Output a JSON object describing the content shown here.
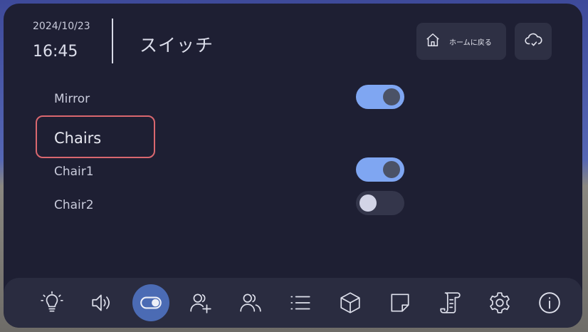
{
  "header": {
    "date": "2024/10/23",
    "time": "16:45",
    "title": "スイッチ",
    "home_button_label": "ホームに戻る"
  },
  "switches": [
    {
      "label": "Mirror",
      "on": true
    },
    {
      "label": "Chair1",
      "on": true
    },
    {
      "label": "Chair2",
      "on": false
    }
  ],
  "section_header": "Chairs",
  "navbar": {
    "active": "toggle-icon",
    "items": [
      "lightbulb-icon",
      "speaker-icon",
      "toggle-icon",
      "add-user-icon",
      "users-icon",
      "list-icon",
      "cube-icon",
      "note-icon",
      "scroll-icon",
      "settings-icon",
      "info-icon"
    ]
  },
  "colors": {
    "panel": "#1e1f33",
    "toggle_on": "#7fa6f2",
    "toggle_off": "#34364b",
    "highlight_border": "#d9676f",
    "nav_active": "#4b6bb4"
  }
}
